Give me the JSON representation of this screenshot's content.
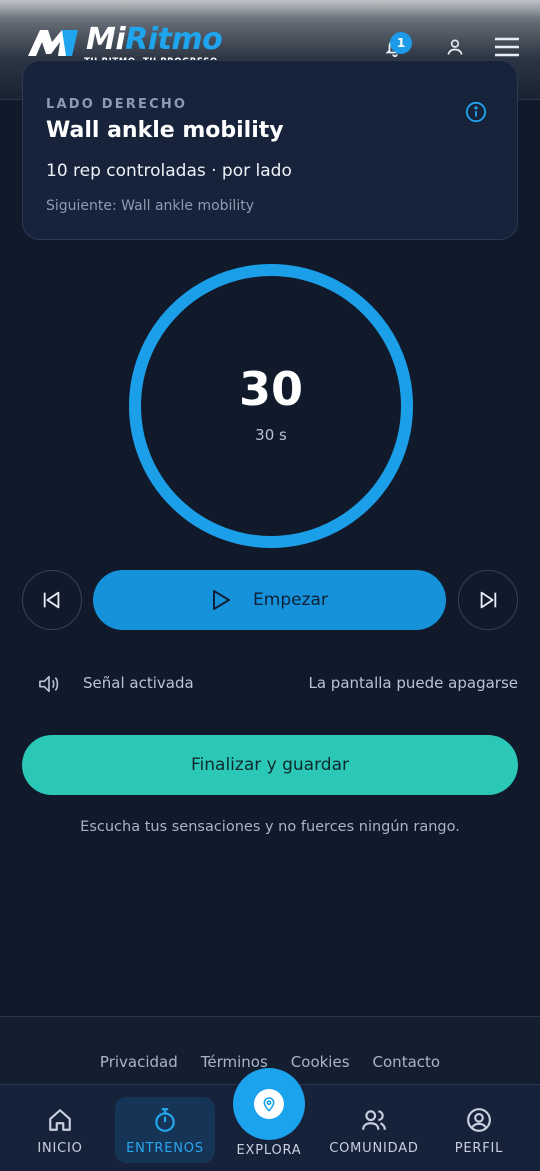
{
  "header": {
    "logo_mi": "Mi",
    "logo_ritmo": "Ritmo",
    "tagline": "TU RITMO. TU PROGRESO.",
    "notification_count": "1"
  },
  "exercise": {
    "side": "LADO DERECHO",
    "title": "Wall ankle mobility",
    "reps": "10 rep controladas · por lado",
    "next": "Siguiente: Wall ankle mobility"
  },
  "timer": {
    "value": "30",
    "subtitle": "30 s",
    "progress": 1.0
  },
  "controls": {
    "start_label": "Empezar",
    "sound_label": "Señal activada",
    "screen_label": "La pantalla puede apagarse",
    "finish_label": "Finalizar y guardar",
    "hint": "Escucha tus sensaciones y no fuerces ningún rango."
  },
  "footer": {
    "links": [
      "Privacidad",
      "Términos",
      "Cookies",
      "Contacto"
    ]
  },
  "nav": {
    "items": [
      {
        "label": "INICIO",
        "icon": "home-icon"
      },
      {
        "label": "ENTRENOS",
        "icon": "stopwatch-icon",
        "active": true
      },
      {
        "label": "EXPLORA",
        "icon": "location-pin-icon"
      },
      {
        "label": "COMUNIDAD",
        "icon": "users-icon"
      },
      {
        "label": "PERFIL",
        "icon": "user-circle-icon"
      }
    ]
  },
  "colors": {
    "background": "#111a2b",
    "accent_blue": "#1ba3ee",
    "accent_teal": "#2cc8b7",
    "card": "#17233a"
  }
}
